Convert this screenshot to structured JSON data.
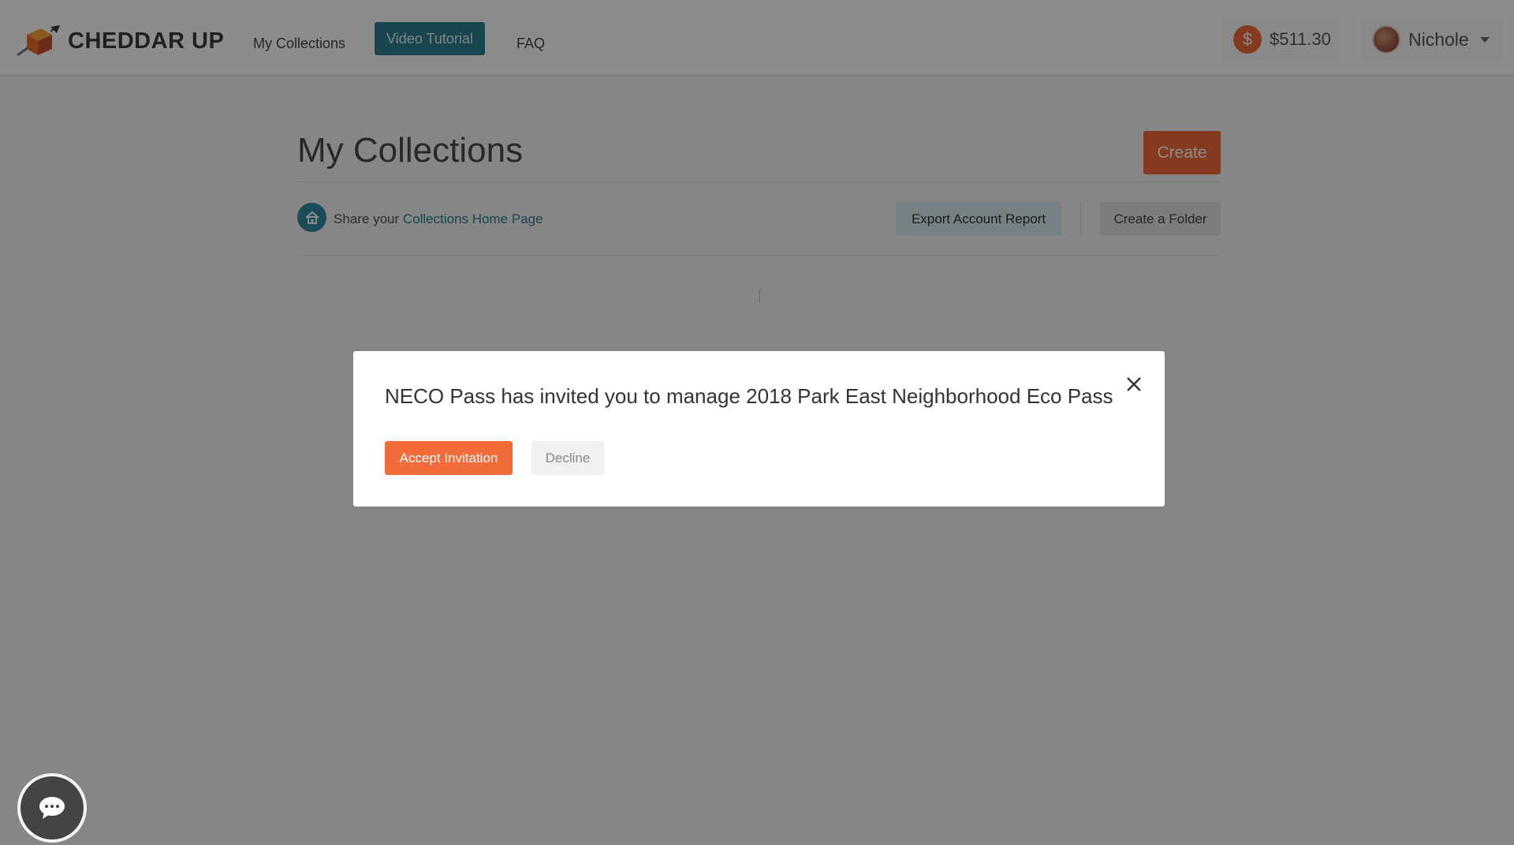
{
  "header": {
    "logo_text": "CHEDDAR UP",
    "nav": {
      "my_collections": "My Collections",
      "video_tutorial": "Video Tutorial",
      "faq": "FAQ"
    },
    "balance": {
      "icon_symbol": "$",
      "amount": "$511.30"
    },
    "user": {
      "name": "Nichole"
    }
  },
  "page": {
    "title": "My Collections",
    "create_label": "Create",
    "share_prefix": "Share your ",
    "share_link": "Collections Home Page",
    "export_label": "Export Account Report",
    "folder_label": "Create a Folder"
  },
  "modal": {
    "message": "NECO Pass has invited you to manage 2018 Park East Neighborhood Eco Pass",
    "accept_label": "Accept Invitation",
    "decline_label": "Decline"
  },
  "colors": {
    "accent_orange": "#f26b3a",
    "accent_teal": "#2f7e8e",
    "overlay": "rgba(0,0,0,0.45)"
  },
  "icons": {
    "logo": "cheddar-up-logo-icon",
    "balance": "dollar-icon",
    "avatar": "avatar",
    "caret": "caret-down-icon",
    "home": "home-icon",
    "close": "close-icon",
    "chat": "chat-icon"
  }
}
